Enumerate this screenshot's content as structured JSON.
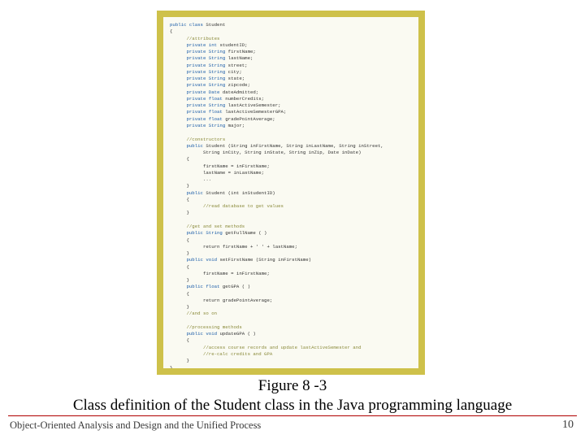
{
  "code": {
    "line01a": "public class",
    "line01b": " Student",
    "line02": "{",
    "line03": "      //attributes",
    "line04a": "      private int",
    "line04b": " studentID;",
    "line05a": "      private String",
    "line05b": " firstName;",
    "line06a": "      private String",
    "line06b": " lastName;",
    "line07a": "      private String",
    "line07b": " street;",
    "line08a": "      private String",
    "line08b": " city;",
    "line09a": "      private String",
    "line09b": " state;",
    "line10a": "      private String",
    "line10b": " zipcode;",
    "line11a": "      private Date",
    "line11b": " dateAdmitted;",
    "line12a": "      private float",
    "line12b": " numberCredits;",
    "line13a": "      private String",
    "line13b": " lastActiveSemester;",
    "line14a": "      private float",
    "line14b": " lastActiveSemesterGPA;",
    "line15a": "      private float",
    "line15b": " gradePointAverage;",
    "line16a": "      private String",
    "line16b": " major;",
    "line17": "",
    "line18": "      //constructors",
    "line19a": "      public",
    "line19b": " Student (String inFirstName, String inLastName, String inStreet,",
    "line20": "            String inCity, String inState, String inZip, Date inDate)",
    "line21": "      {",
    "line22": "            firstName = inFirstName;",
    "line23": "            lastName = inLastName;",
    "line24": "            ...",
    "line25": "      }",
    "line26a": "      public",
    "line26b": " Student (int",
    "line26c": " inStudentID)",
    "line27": "      {",
    "line28": "            //read database to get values",
    "line29": "      }",
    "line30": "",
    "line31": "      //get and set methods",
    "line32a": "      public String",
    "line32b": " getFullName ( )",
    "line33": "      {",
    "line34": "            return firstName + ' ' + lastName;",
    "line35": "      }",
    "line36a": "      public void",
    "line36b": " setFirstName (String inFirstName)",
    "line37": "      {",
    "line38": "            firstName = inFirstName;",
    "line39": "      }",
    "line40a": "      public float",
    "line40b": " getGPA ( )",
    "line41": "      {",
    "line42": "            return gradePointAverage;",
    "line43": "      }",
    "line44": "      //and so on",
    "line45": "",
    "line46": "      //processing methods",
    "line47a": "      public void",
    "line47b": " updateGPA ( )",
    "line48": "      {",
    "line49": "            //access course records and update lastActiveSemester and",
    "line50": "            //re-calc credits and GPA",
    "line51": "      }",
    "line52": "}"
  },
  "caption": {
    "line1": "Figure 8 -3",
    "line2": "Class definition of the Student class in the Java programming language"
  },
  "footer": {
    "left": "Object-Oriented Analysis and Design and the Unified Process",
    "right": "10"
  }
}
